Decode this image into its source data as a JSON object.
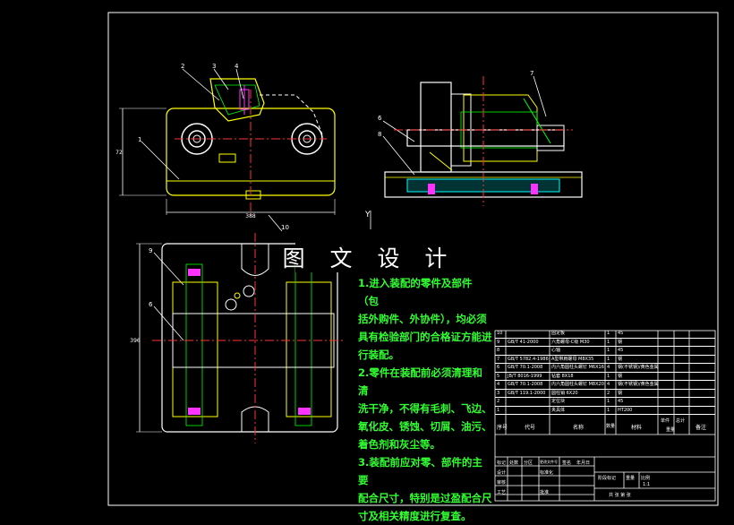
{
  "banner": "图 文 设 计",
  "notes": [
    "1.进入装配的零件及部件（包",
    "括外购件、外协件），均必须",
    "具有检验部门的合格证方能进",
    "行装配。",
    "2.零件在装配前必须清理和清",
    "洗干净，不得有毛刺、飞边、",
    "氧化皮、锈蚀、切屑、油污、",
    "着色剂和灰尘等。",
    "3.装配前应对零、部件的主要",
    "配合尺寸，特别是过盈配合尺",
    "寸及相关精度进行复查。"
  ],
  "balloons": [
    "1",
    "2",
    "3",
    "4",
    "5",
    "6",
    "7",
    "8",
    "9",
    "10"
  ],
  "dims": {
    "w1": "388",
    "h1": "72",
    "h2": "396"
  },
  "axis_label": "Y",
  "bom_rows": [
    {
      "no": "10",
      "code": "",
      "name": "固定板",
      "qty": "1",
      "mat": "45"
    },
    {
      "no": "9",
      "code": "GB/T 41-2000",
      "name": "六角螺母-C级 M30",
      "qty": "1",
      "mat": "钢"
    },
    {
      "no": "8",
      "code": "",
      "name": "心轴",
      "qty": "1",
      "mat": "45"
    },
    {
      "no": "7",
      "code": "GB/T 5782.4-1986",
      "name": "A型带肩螺母 M8X35",
      "qty": "1",
      "mat": "钢"
    },
    {
      "no": "6",
      "code": "GB/T 70.1-2008",
      "name": "内六角圆柱头螺钉 M6X16",
      "qty": "4",
      "mat": "钢(不锈钢)/黄色金属"
    },
    {
      "no": "5",
      "code": "JB/T 8016-1999",
      "name": "钻套 8X18",
      "qty": "1",
      "mat": "钢"
    },
    {
      "no": "4",
      "code": "GB/T 70.1-2008",
      "name": "内六角圆柱头螺钉 M8X20",
      "qty": "4",
      "mat": "钢(不锈钢)/黄色金属"
    },
    {
      "no": "3",
      "code": "GB/T 119.1-2000",
      "name": "圆柱销 6X20",
      "qty": "2",
      "mat": "钢"
    },
    {
      "no": "2",
      "code": "",
      "name": "定位块",
      "qty": "1",
      "mat": "45"
    },
    {
      "no": "1",
      "code": "",
      "name": "夹具体",
      "qty": "1",
      "mat": "HT200"
    }
  ],
  "bom_header": {
    "no": "序号",
    "code": "代号",
    "name": "名称",
    "qty": "数量",
    "mat": "材料",
    "w1": "单件",
    "w2": "总计",
    "weight": "重量",
    "remark": "备注"
  },
  "title_block": {
    "labels": [
      "标记",
      "处数",
      "分区",
      "更改文件号",
      "签名",
      "年月日",
      "设计",
      "标准化",
      "审核",
      "工艺",
      "批准",
      "阶段标记",
      "重量",
      "比例"
    ],
    "scale": "1:1",
    "sheet": "共 张 第 张"
  },
  "colors": {
    "bg": "#000000",
    "line": "#ffffff",
    "part": "#ffff00",
    "center": "#ff3333",
    "green": "#00ff00",
    "hatch": "#00ffff",
    "magenta": "#ff33ff",
    "note": "#32ff32"
  }
}
